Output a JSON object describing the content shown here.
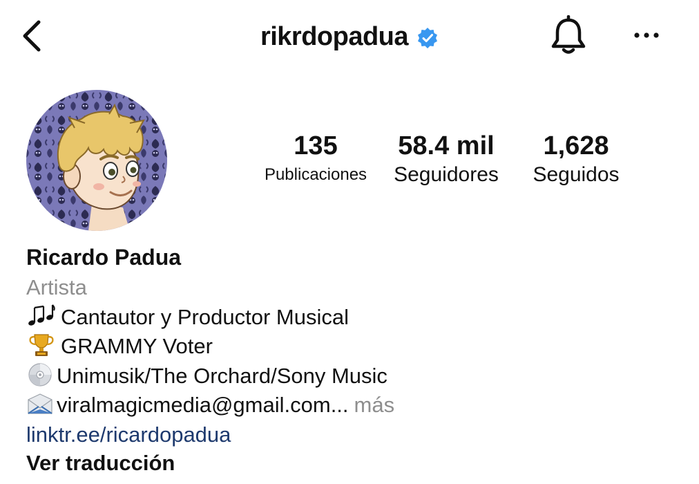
{
  "header": {
    "back_icon": "chevron-left-icon",
    "username": "rikrdopadua",
    "verified_icon": "verified-badge-icon",
    "notifications_icon": "bell-icon",
    "more_icon": "ellipsis-icon",
    "accent_color": "#3897f0"
  },
  "stats": {
    "posts": {
      "value": "135",
      "label": "Publicaciones"
    },
    "followers": {
      "value": "58.4 mil",
      "label": "Seguidores"
    },
    "following": {
      "value": "1,628",
      "label": "Seguidos"
    }
  },
  "profile": {
    "name": "Ricardo Padua",
    "category": "Artista",
    "bio": [
      {
        "icon": "music-notes-icon",
        "text": "Cantautor y Productor Musical"
      },
      {
        "icon": "trophy-icon",
        "text": "GRAMMY Voter"
      },
      {
        "icon": "cd-icon",
        "text": "Unimusik/The Orchard/Sony Music"
      },
      {
        "icon": "envelope-icon",
        "text": "viralmagicmedia@gmail.com..."
      }
    ],
    "more_label": "más",
    "link": "linktr.ee/ricardopadua",
    "translate_label": "Ver traducción"
  }
}
